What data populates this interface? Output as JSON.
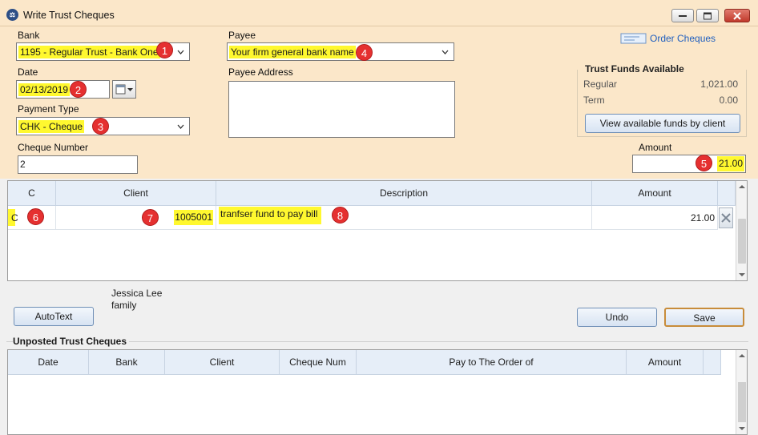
{
  "window": {
    "title": "Write Trust Cheques",
    "icon": "law-firm-icon"
  },
  "form": {
    "bank_label": "Bank",
    "bank_value": "1195 - Regular Trust - Bank One",
    "date_label": "Date",
    "date_value": "02/13/2019",
    "payment_type_label": "Payment Type",
    "payment_type_value": "CHK - Cheque",
    "cheque_number_label": "Cheque Number",
    "cheque_number_value": "2",
    "payee_label": "Payee",
    "payee_value": "Your firm general bank name",
    "payee_address_label": "Payee Address",
    "payee_address_value": "",
    "amount_label": "Amount",
    "amount_value": "21.00",
    "order_cheques_label": "Order Cheques"
  },
  "trust_funds": {
    "title": "Trust Funds Available",
    "regular_label": "Regular",
    "regular_value": "1,021.00",
    "term_label": "Term",
    "term_value": "0.00",
    "view_button": "View available funds by client"
  },
  "badges": [
    "1",
    "2",
    "3",
    "4",
    "5",
    "6",
    "7",
    "8"
  ],
  "grid": {
    "headers": {
      "c": "C",
      "client": "Client",
      "description": "Description",
      "amount": "Amount"
    },
    "rows": [
      {
        "c": "C",
        "client": "1005001",
        "description": "tranfser fund to pay bill",
        "amount": "21.00"
      }
    ]
  },
  "client_info": {
    "name": "Jessica Lee",
    "matter": "family"
  },
  "buttons": {
    "autotext": "AutoText",
    "undo": "Undo",
    "save": "Save"
  },
  "unposted": {
    "title": "Unposted Trust Cheques",
    "headers": {
      "date": "Date",
      "bank": "Bank",
      "client": "Client",
      "cheque_num": "Cheque Num",
      "pay_to": "Pay to The Order of",
      "amount": "Amount"
    }
  },
  "colors": {
    "form_bg": "#fbe7c9",
    "highlight": "#fff82f",
    "badge": "#e53030",
    "link": "#1f5fbf"
  }
}
